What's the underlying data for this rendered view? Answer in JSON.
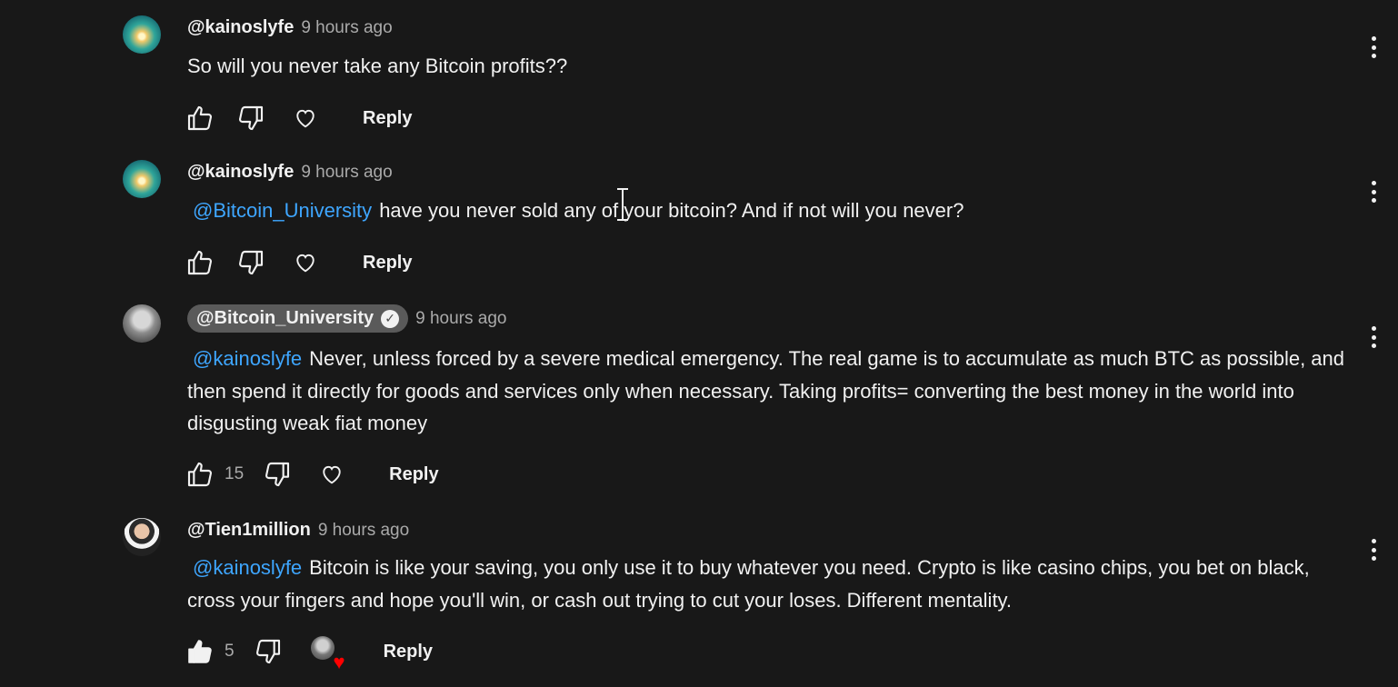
{
  "colors": {
    "background": "#181818",
    "mention": "#3ea6ff",
    "heart": "#ff0000",
    "muted": "#aaaaaa"
  },
  "comments": [
    {
      "author": "@kainoslyfe",
      "time": "9 hours ago",
      "mention": "",
      "text": "So will you never take any Bitcoin profits??",
      "likes": "",
      "reply": "Reply"
    },
    {
      "author": "@kainoslyfe",
      "time": "9 hours ago",
      "mention": "@Bitcoin_University",
      "text": "have you never sold any of your bitcoin? And if not will you never?",
      "likes": "",
      "reply": "Reply"
    },
    {
      "author": "@Bitcoin_University",
      "time": "9 hours ago",
      "mention": "@kainoslyfe",
      "text": "Never, unless forced by a severe medical emergency. The real game is to accumulate as much BTC as possible, and then spend it directly for goods and services only when necessary. Taking profits= converting the best money in the world into disgusting weak fiat money",
      "likes": "15",
      "reply": "Reply"
    },
    {
      "author": "@Tien1million",
      "time": "9 hours ago",
      "mention": "@kainoslyfe",
      "text": "Bitcoin is like your saving, you only use it to buy whatever you need.  Crypto is like casino chips, you bet on black, cross your fingers and hope you'll win, or cash out trying to cut your loses.  Different mentality.",
      "likes": "5",
      "reply": "Reply"
    }
  ],
  "icons": {
    "like": "thumbs-up-icon",
    "dislike": "thumbs-down-icon",
    "heart": "heart-icon",
    "menu": "more-vert-icon",
    "verified": "verified-check-icon",
    "cursor": "text-cursor-icon"
  }
}
